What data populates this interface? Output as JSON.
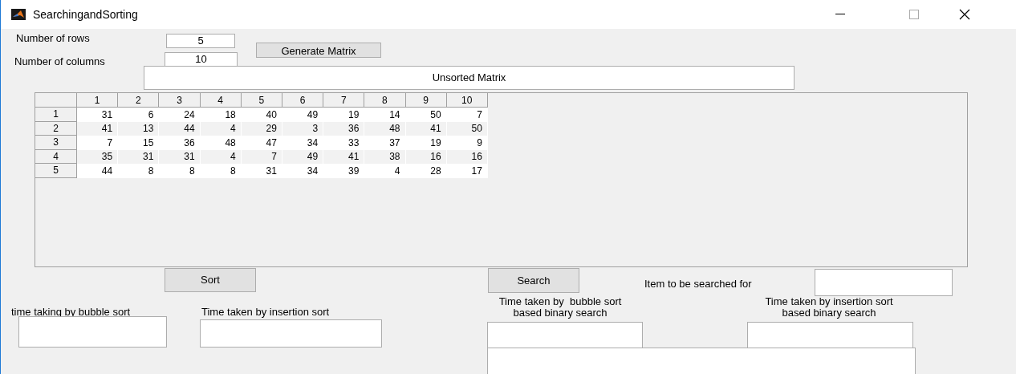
{
  "window": {
    "title": "SearchingandSorting"
  },
  "rows_label": "Number of rows",
  "rows_value": "5",
  "columns_label": "Number of columns",
  "columns_value": "10",
  "generate_button": "Generate Matrix",
  "matrix_title": "Unsorted Matrix",
  "table": {
    "columns": [
      "1",
      "2",
      "3",
      "4",
      "5",
      "6",
      "7",
      "8",
      "9",
      "10"
    ],
    "rows": [
      {
        "label": "1",
        "cells": [
          "31",
          "6",
          "24",
          "18",
          "40",
          "49",
          "19",
          "14",
          "50",
          "7"
        ]
      },
      {
        "label": "2",
        "cells": [
          "41",
          "13",
          "44",
          "4",
          "29",
          "3",
          "36",
          "48",
          "41",
          "50"
        ]
      },
      {
        "label": "3",
        "cells": [
          "7",
          "15",
          "36",
          "48",
          "47",
          "34",
          "33",
          "37",
          "19",
          "9"
        ]
      },
      {
        "label": "4",
        "cells": [
          "35",
          "31",
          "31",
          "4",
          "7",
          "49",
          "41",
          "38",
          "16",
          "16"
        ]
      },
      {
        "label": "5",
        "cells": [
          "44",
          "8",
          "8",
          "8",
          "31",
          "34",
          "39",
          "4",
          "28",
          "17"
        ]
      }
    ]
  },
  "sort_button": "Sort",
  "search_button": "Search",
  "search_label": "Item to be searched for",
  "bubble_time_label": "time taking by bubble sort",
  "insertion_time_label": "Time taken by insertion sort",
  "bubble_search_label": [
    "Time taken by  bubble sort",
    "based binary search"
  ],
  "insertion_search_label": [
    "Time taken by insertion sort",
    "based binary search"
  ]
}
